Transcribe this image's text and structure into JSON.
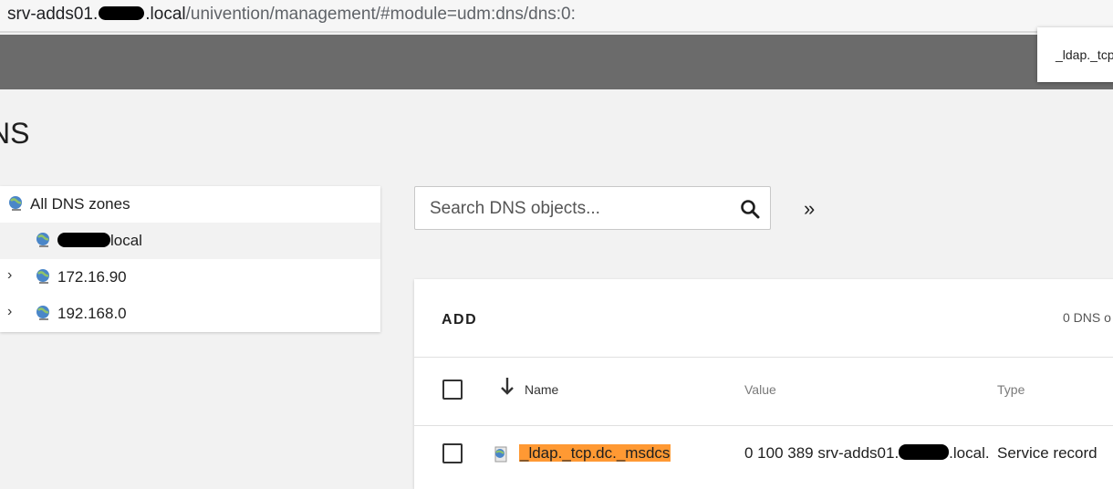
{
  "browser": {
    "url_host_prefix": "srv-adds01.",
    "url_host_suffix": ".local",
    "url_path": "/univention/management/#module=udm:dns/dns:0:"
  },
  "tooltip": {
    "text": "_ldap._tcp"
  },
  "page": {
    "title": "NS"
  },
  "tree": {
    "items": [
      {
        "label": "All DNS zones",
        "icon": "globe-icon",
        "expandable": false
      },
      {
        "label_suffix": "local",
        "icon": "globe-icon",
        "expandable": false,
        "selected": true
      },
      {
        "label": "172.16.90",
        "icon": "globe-icon",
        "expandable": true
      },
      {
        "label": "192.168.0",
        "icon": "globe-icon",
        "expandable": true
      }
    ]
  },
  "search": {
    "placeholder": "Search DNS objects...",
    "value": ""
  },
  "expand_toggle": "»",
  "grid": {
    "add_label": "ADD",
    "count_text": "0 DNS o",
    "columns": {
      "name": "Name",
      "value": "Value",
      "type": "Type"
    },
    "rows": [
      {
        "name": "_ldap._tcp.dc._msdcs",
        "value_prefix": "0 100 389 srv-adds01.",
        "value_suffix": ".local.",
        "type": "Service record"
      }
    ]
  },
  "colors": {
    "header": "#6b6b6b",
    "highlight": "#ff9933",
    "background": "#f2f2f2"
  }
}
